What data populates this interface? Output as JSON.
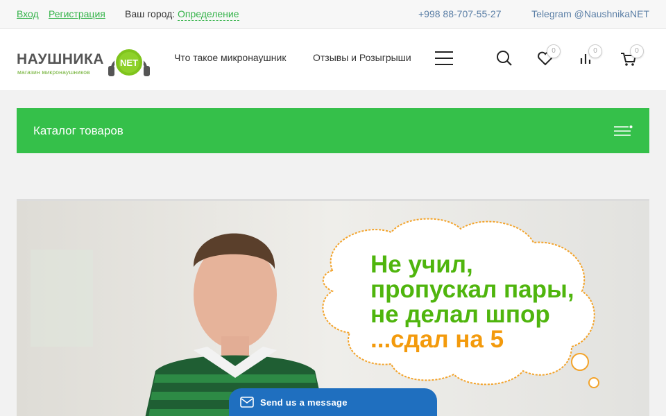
{
  "topbar": {
    "login": "Вход",
    "register": "Регистрация",
    "city_label": "Ваш город:",
    "city_value": "Определение",
    "phone": "+998 88-707-55-27",
    "telegram": "Telegram @NaushnikaNET"
  },
  "header": {
    "logo_text": "НАУШНИКА",
    "logo_badge": "NET",
    "logo_sub": "магазин микронаушников",
    "nav": [
      "Что такое микронаушник",
      "Отзывы и Розыгрыши"
    ],
    "wishlist_count": "0",
    "compare_count": "0",
    "cart_count": "0"
  },
  "catalog": {
    "label": "Каталог товаров"
  },
  "banner": {
    "line1": "Не учил,",
    "line2": "пропускал пары,",
    "line3": "не делал шпор",
    "line4": "...сдал на 5"
  },
  "chat": {
    "label": "Send us a message"
  },
  "colors": {
    "accent": "#35c04a",
    "link": "#5b7fa6",
    "banner_green": "#4fb50d",
    "banner_orange": "#f39a0c",
    "chat": "#1f6fbf"
  },
  "icons": [
    "search-icon",
    "heart-icon",
    "compare-icon",
    "cart-icon",
    "menu-icon",
    "envelope-icon"
  ]
}
